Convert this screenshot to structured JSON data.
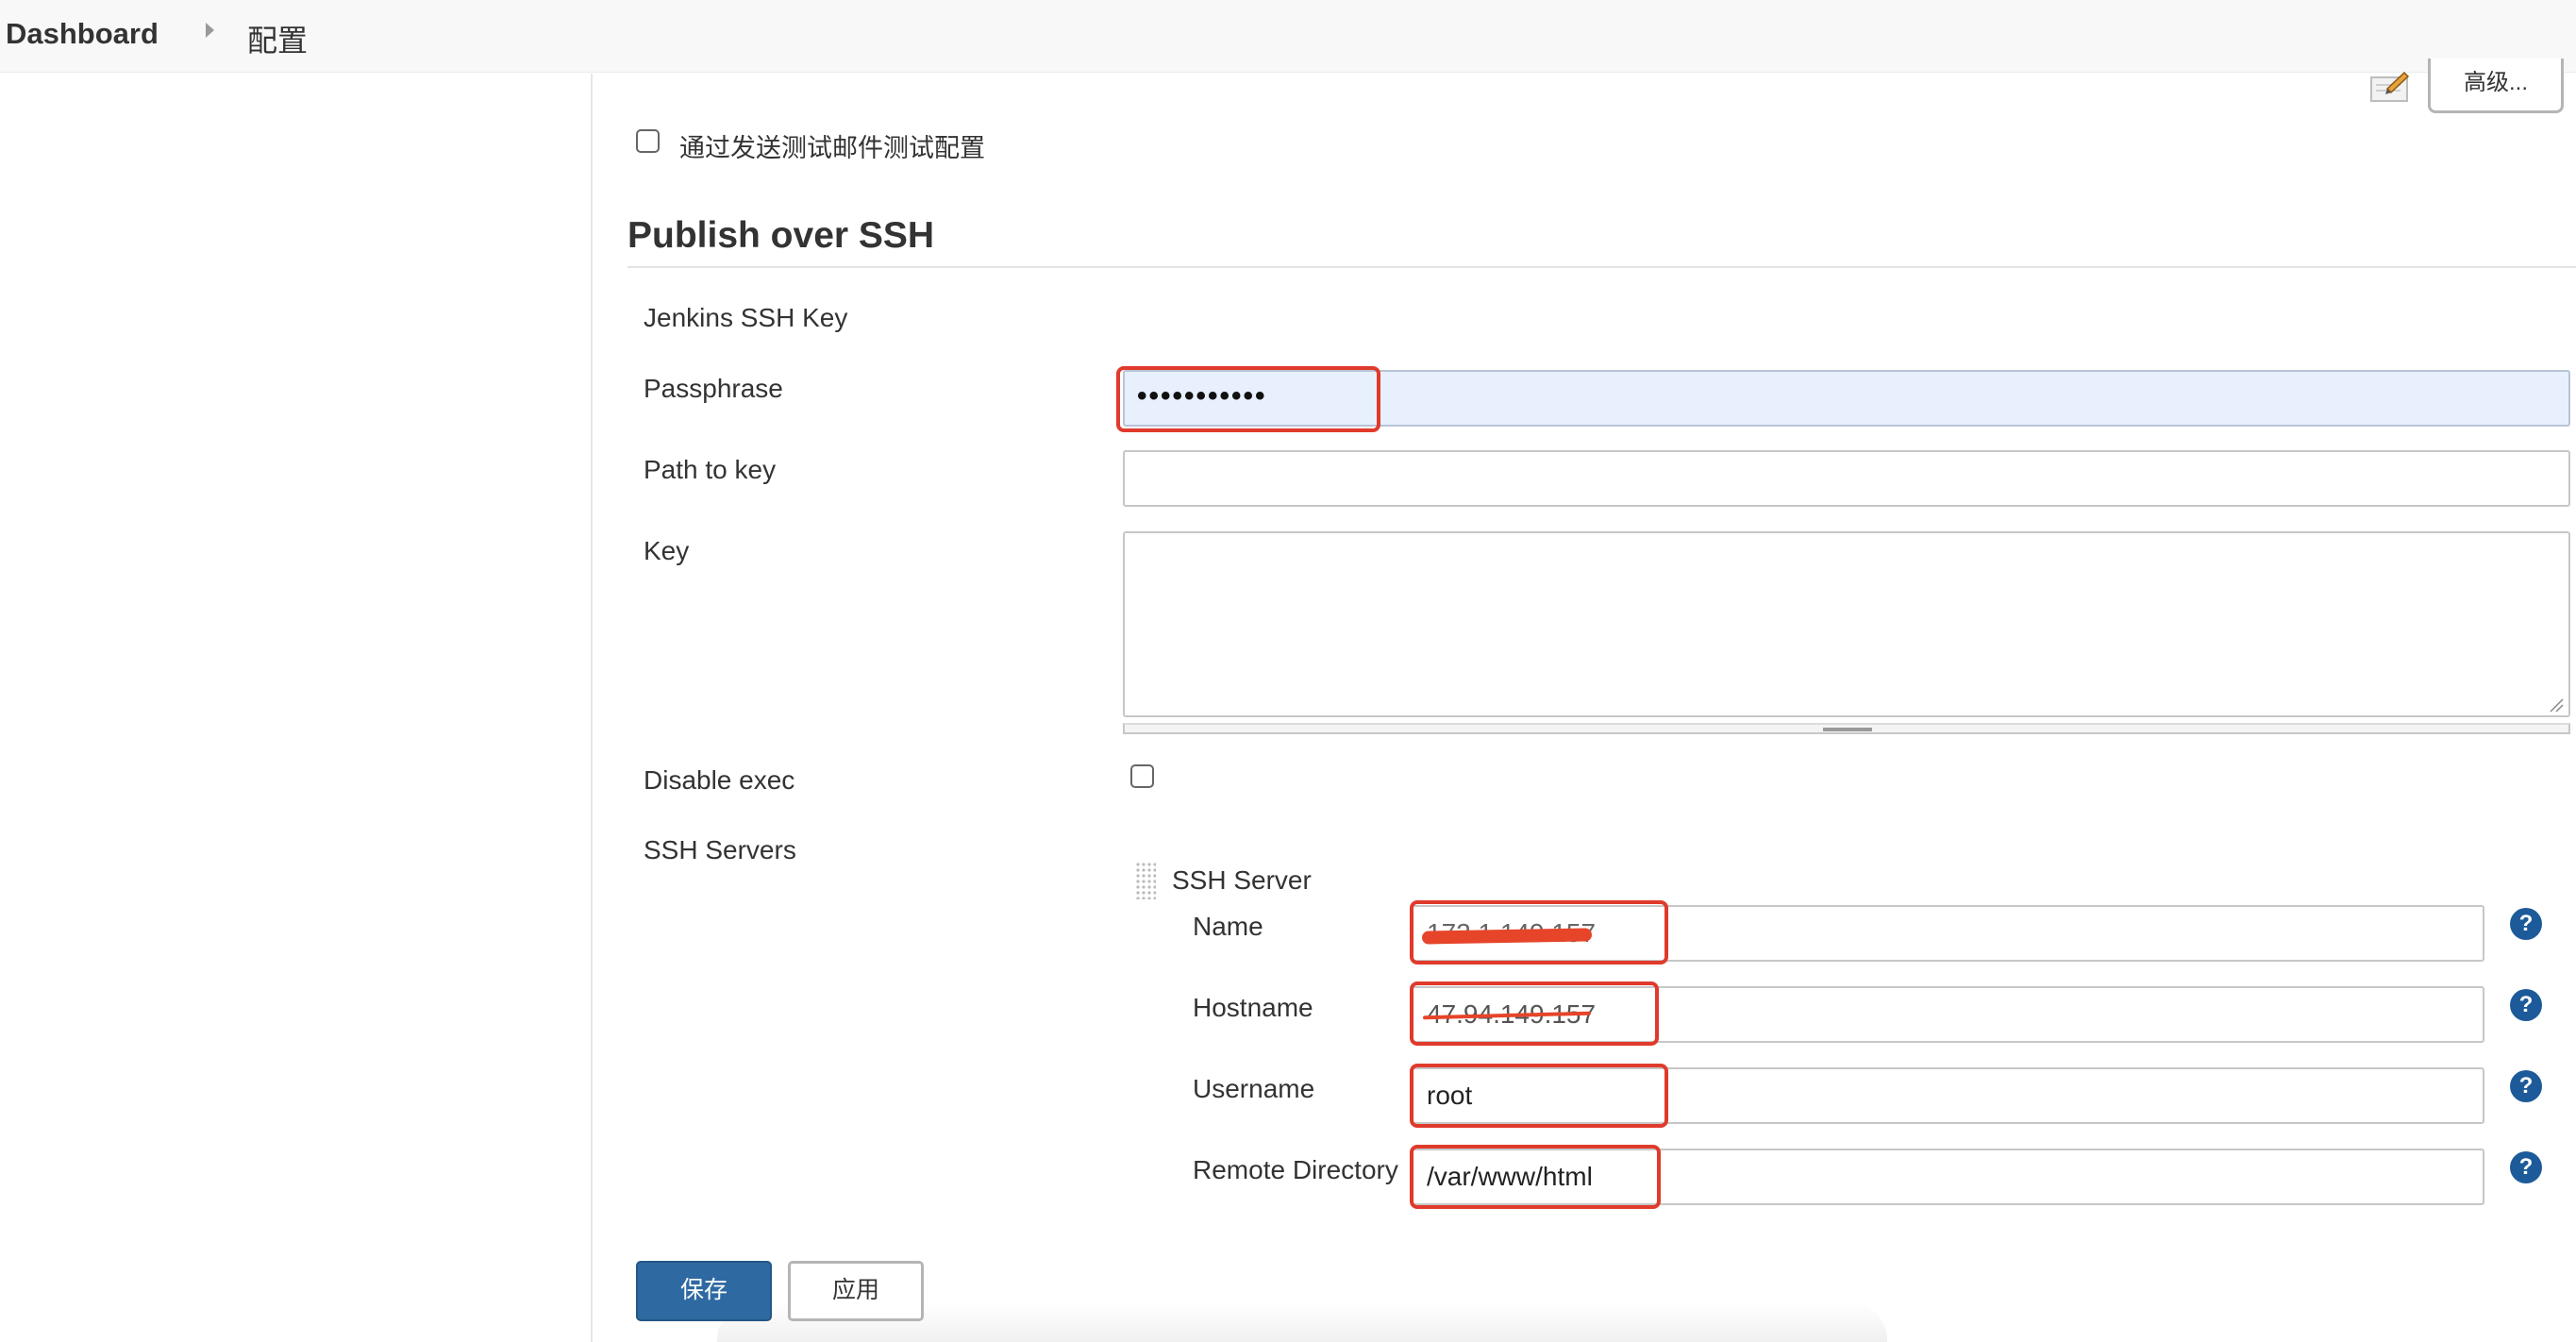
{
  "breadcrumb": {
    "home": "Dashboard",
    "current": "配置"
  },
  "toolbar": {
    "advanced_label": "高级..."
  },
  "test_mail": {
    "label": "通过发送测试邮件测试配置",
    "checked": false
  },
  "section": {
    "title": "Publish over SSH"
  },
  "ssh_key": {
    "heading": "Jenkins SSH Key",
    "passphrase_label": "Passphrase",
    "passphrase_value": "•••••••••••",
    "path_label": "Path to key",
    "path_value": "",
    "key_label": "Key",
    "key_value": "",
    "disable_exec_label": "Disable exec",
    "disable_exec_checked": false
  },
  "ssh_servers": {
    "label": "SSH Servers",
    "server_title": "SSH Server",
    "fields": {
      "name_label": "Name",
      "name_value": "172.1.149.157",
      "hostname_label": "Hostname",
      "hostname_value": "47.94.149.157",
      "username_label": "Username",
      "username_value": "root",
      "remote_dir_label": "Remote Directory",
      "remote_dir_value": "/var/www/html"
    },
    "help_glyph": "?"
  },
  "buttons": {
    "save": "保存",
    "apply": "应用"
  },
  "icons": [
    "chevron-right-icon",
    "notepad-icon",
    "drag-handle-icon",
    "help-icon"
  ],
  "colors": {
    "primary": "#2e6aa1",
    "annotation": "#e03a2c",
    "help": "#1d5a9a",
    "autofill": "#e8f0fe"
  }
}
